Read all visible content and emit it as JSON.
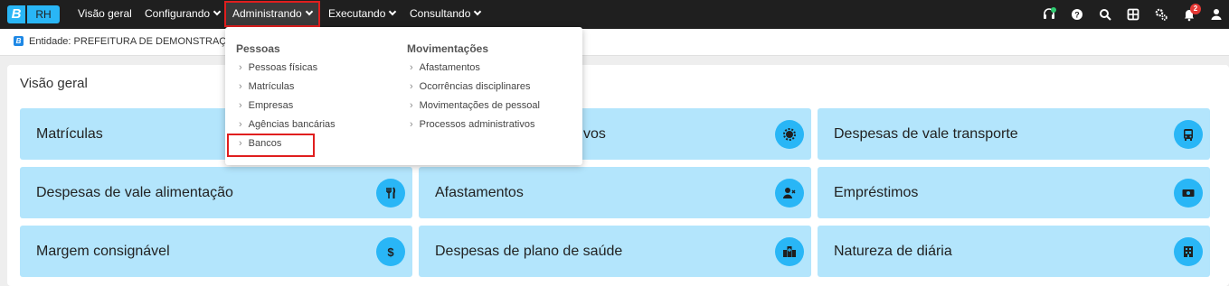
{
  "logo": {
    "mark": "B",
    "text": "RH"
  },
  "nav": {
    "visao_geral": "Visão geral",
    "configurando": "Configurando",
    "administrando": "Administrando",
    "executando": "Executando",
    "consultando": "Consultando"
  },
  "topbar_icons": [
    "headset-icon",
    "help-icon",
    "search-icon",
    "apps-grid-icon",
    "settings-icon",
    "bell-icon",
    "user-icon"
  ],
  "notifications": {
    "count": "2"
  },
  "entity": {
    "label": "Entidade: PREFEITURA DE DEMONSTRAÇÃO"
  },
  "overview": {
    "title": "Visão geral",
    "cards": [
      {
        "label": "Matrículas"
      },
      {
        "label": "uisitivos",
        "icon": "gear-icon"
      },
      {
        "label": "Despesas de vale transporte",
        "icon": "bus-icon"
      },
      {
        "label": "Despesas de vale alimentação",
        "icon": "cutlery-icon"
      },
      {
        "label": "Afastamentos",
        "icon": "user-remove-icon"
      },
      {
        "label": "Empréstimos",
        "icon": "money-icon"
      },
      {
        "label": "Margem consignável",
        "icon": "dollar-icon"
      },
      {
        "label": "Despesas de plano de saúde",
        "icon": "hospital-icon"
      },
      {
        "label": "Natureza de diária",
        "icon": "building-icon"
      }
    ]
  },
  "dropdown": {
    "pessoas": {
      "title": "Pessoas",
      "items": [
        "Pessoas físicas",
        "Matrículas",
        "Empresas",
        "Agências bancárias",
        "Bancos"
      ]
    },
    "movimentacoes": {
      "title": "Movimentações",
      "items": [
        "Afastamentos",
        "Ocorrências disciplinares",
        "Movimentações de pessoal",
        "Processos administrativos"
      ]
    },
    "arrow": "›"
  },
  "colors": {
    "topbar": "#1f1f1f",
    "accent": "#29b6f6",
    "card_bg": "#b3e5fc",
    "highlight": "#e01e1e"
  }
}
